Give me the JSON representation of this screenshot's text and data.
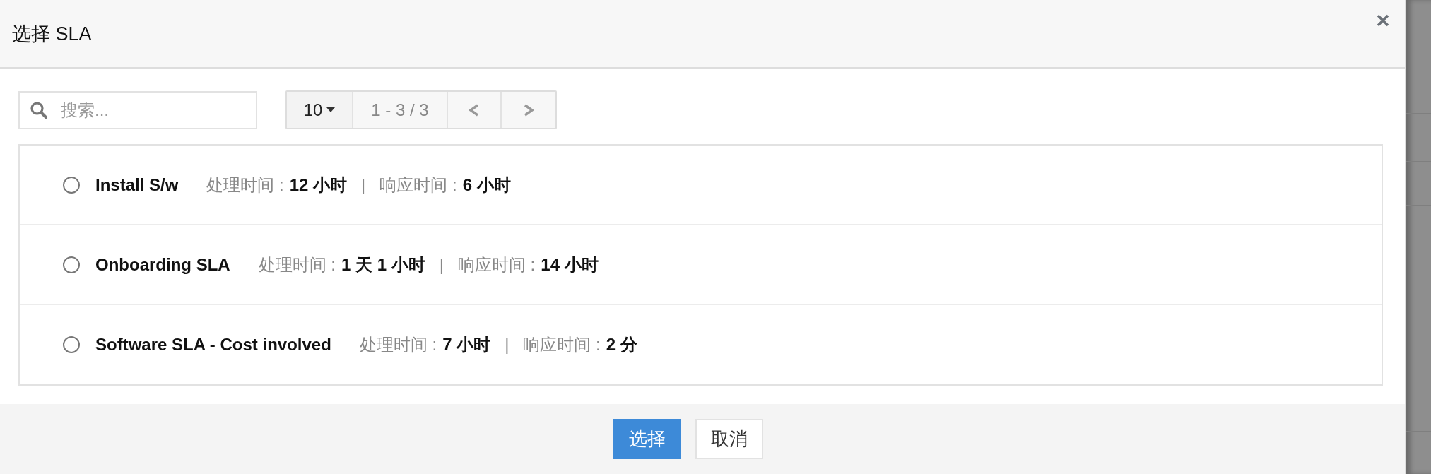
{
  "dialog": {
    "title": "选择 SLA"
  },
  "search": {
    "placeholder": "搜索..."
  },
  "pager": {
    "page_size": "10",
    "range": "1 - 3 / 3"
  },
  "rows": [
    {
      "name": "Install S/w",
      "resolve_label": "处理时间 :",
      "resolve_value": "12 小时",
      "separator": "|",
      "response_label": "响应时间 :",
      "response_value": "6 小时",
      "selected": false
    },
    {
      "name": "Onboarding SLA",
      "resolve_label": "处理时间 :",
      "resolve_value": "1 天 1 小时",
      "separator": "|",
      "response_label": "响应时间 :",
      "response_value": "14 小时",
      "selected": false
    },
    {
      "name": "Software SLA - Cost involved",
      "resolve_label": "处理时间 :",
      "resolve_value": "7 小时",
      "separator": "|",
      "response_label": "响应时间 :",
      "response_value": "2 分",
      "selected": false
    }
  ],
  "buttons": [
    {
      "label": "选择",
      "kind": "primary"
    },
    {
      "label": "取消",
      "kind": "secondary"
    }
  ]
}
